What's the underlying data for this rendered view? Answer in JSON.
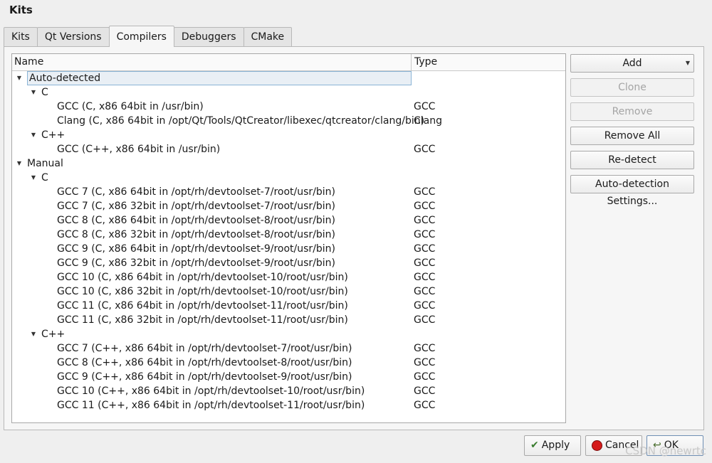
{
  "window": {
    "title": "Kits"
  },
  "tabs": [
    {
      "label": "Kits",
      "active": false
    },
    {
      "label": "Qt Versions",
      "active": false
    },
    {
      "label": "Compilers",
      "active": true
    },
    {
      "label": "Debuggers",
      "active": false
    },
    {
      "label": "CMake",
      "active": false
    }
  ],
  "tree": {
    "columns": {
      "name": "Name",
      "type": "Type"
    },
    "rows": [
      {
        "label": "Auto-detected",
        "type": "",
        "level": 0,
        "expandable": true,
        "selected": true
      },
      {
        "label": "C",
        "type": "",
        "level": 1,
        "expandable": true
      },
      {
        "label": "GCC (C, x86 64bit in /usr/bin)",
        "type": "GCC",
        "level": 2
      },
      {
        "label": "Clang (C, x86 64bit in /opt/Qt/Tools/QtCreator/libexec/qtcreator/clang/bin)",
        "type": "Clang",
        "level": 2
      },
      {
        "label": "C++",
        "type": "",
        "level": 1,
        "expandable": true
      },
      {
        "label": "GCC (C++, x86 64bit in /usr/bin)",
        "type": "GCC",
        "level": 2
      },
      {
        "label": "Manual",
        "type": "",
        "level": 0,
        "expandable": true
      },
      {
        "label": "C",
        "type": "",
        "level": 1,
        "expandable": true
      },
      {
        "label": "GCC 7 (C, x86 64bit in /opt/rh/devtoolset-7/root/usr/bin)",
        "type": "GCC",
        "level": 2
      },
      {
        "label": "GCC 7 (C, x86 32bit in /opt/rh/devtoolset-7/root/usr/bin)",
        "type": "GCC",
        "level": 2
      },
      {
        "label": "GCC 8 (C, x86 64bit in /opt/rh/devtoolset-8/root/usr/bin)",
        "type": "GCC",
        "level": 2
      },
      {
        "label": "GCC 8 (C, x86 32bit in /opt/rh/devtoolset-8/root/usr/bin)",
        "type": "GCC",
        "level": 2
      },
      {
        "label": "GCC 9 (C, x86 64bit in /opt/rh/devtoolset-9/root/usr/bin)",
        "type": "GCC",
        "level": 2
      },
      {
        "label": "GCC 9 (C, x86 32bit in /opt/rh/devtoolset-9/root/usr/bin)",
        "type": "GCC",
        "level": 2
      },
      {
        "label": "GCC 10 (C, x86 64bit in /opt/rh/devtoolset-10/root/usr/bin)",
        "type": "GCC",
        "level": 2
      },
      {
        "label": "GCC 10 (C, x86 32bit in /opt/rh/devtoolset-10/root/usr/bin)",
        "type": "GCC",
        "level": 2
      },
      {
        "label": "GCC 11 (C, x86 64bit in /opt/rh/devtoolset-11/root/usr/bin)",
        "type": "GCC",
        "level": 2
      },
      {
        "label": "GCC 11 (C, x86 32bit in /opt/rh/devtoolset-11/root/usr/bin)",
        "type": "GCC",
        "level": 2
      },
      {
        "label": "C++",
        "type": "",
        "level": 1,
        "expandable": true
      },
      {
        "label": "GCC 7 (C++, x86 64bit in /opt/rh/devtoolset-7/root/usr/bin)",
        "type": "GCC",
        "level": 2
      },
      {
        "label": "GCC 8 (C++, x86 64bit in /opt/rh/devtoolset-8/root/usr/bin)",
        "type": "GCC",
        "level": 2
      },
      {
        "label": "GCC 9 (C++, x86 64bit in /opt/rh/devtoolset-9/root/usr/bin)",
        "type": "GCC",
        "level": 2
      },
      {
        "label": "GCC 10 (C++, x86 64bit in /opt/rh/devtoolset-10/root/usr/bin)",
        "type": "GCC",
        "level": 2
      },
      {
        "label": "GCC 11 (C++, x86 64bit in /opt/rh/devtoolset-11/root/usr/bin)",
        "type": "GCC",
        "level": 2
      }
    ]
  },
  "side_buttons": {
    "add": "Add",
    "clone": "Clone",
    "remove": "Remove",
    "remove_all": "Remove All",
    "redetect": "Re-detect",
    "autodetect_settings": "Auto-detection Settings..."
  },
  "dialog_buttons": {
    "apply": "Apply",
    "cancel": "Cancel",
    "ok": "OK"
  },
  "watermark": "CSDN @newrtc",
  "icons": {
    "expand": "triangle-down-icon",
    "apply": "check-icon",
    "cancel": "cancel-icon",
    "ok": "ok-icon"
  },
  "colors": {
    "selection_border": "#8ab4d6",
    "selection_fill": "#e9eff5",
    "cancel_red": "#d51b1b"
  }
}
